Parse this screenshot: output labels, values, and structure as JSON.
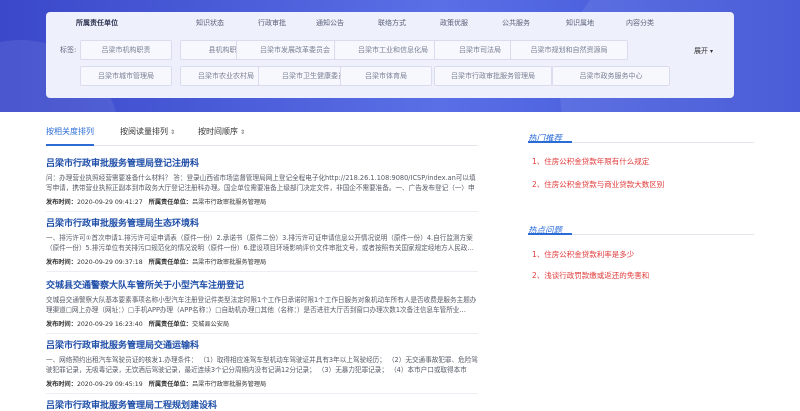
{
  "categories": [
    {
      "label": "所属责任单位",
      "active": true
    },
    {
      "label": "知识状态"
    },
    {
      "label": "行政审批"
    },
    {
      "label": "通知公告"
    },
    {
      "label": "联络方式"
    },
    {
      "label": "政策优服"
    },
    {
      "label": "公共服务"
    },
    {
      "label": "知识属地"
    },
    {
      "label": "内容分类"
    }
  ],
  "tags_label": "标签:",
  "tags": [
    "吕梁市机构职责",
    "县机构职责",
    "吕梁市发展改革委员会",
    "吕梁市工业和信息化局",
    "吕梁市司法局",
    "吕梁市规划和自然资源局",
    "吕梁市城市管理局",
    "吕梁市农业农村局",
    "吕梁市卫生健康委员会",
    "吕梁市体育局",
    "吕梁市行政审批服务管理局",
    "吕梁市政务服务中心"
  ],
  "expand_label": "展开",
  "sort_options": [
    {
      "label": "按相关度排列",
      "active": true
    },
    {
      "label": "按阅读量排列"
    },
    {
      "label": "按时间顺序"
    }
  ],
  "results": [
    {
      "title": "吕梁市行政审批服务管理局登记注册科",
      "desc": "问：办理营业执照经营需要准备什么材料？ 答：登录山西省市场监督管理局网上登记全程电子化http://218.26.1.108:9080/ICSP/index.an可以填写申请，携带营业执照正副本到市政务大厅登记注册科办理。国企单位需要准备上级部门决定文件，非国企不需要准备。一、广告发布登记（一）申请…",
      "published_label": "发布时间：",
      "published": "2020-09-29 09:41:27",
      "unit_label": "所属责任单位：",
      "unit": "吕梁市行政审批服务管理局"
    },
    {
      "title": "吕梁市行政审批服务管理局生态环境科",
      "desc": "一、排污许可①首次申请1.排污许可证申请表（原件一份）2.承诺书（原件二份）3.排污许可证申请信息公开情况说明（原件一份）4.自行监测方案（原件一份）5.排污单位有关排污口规范化的情况说明（原件一份）6.建设项目环境影响评价文件审批文号，或者按照有关国家规定经地方人民政…",
      "published_label": "发布时间：",
      "published": "2020-09-29 09:37:18",
      "unit_label": "所属责任单位：",
      "unit": "吕梁市行政审批服务管理局"
    },
    {
      "title": "交城县交通警察大队车管所关于小型汽车注册登记",
      "desc": "交城县交通警察大队基本要素事项名称小型汽车注册登记件类型法定时限1个工作日承诺时限1个工作日服务对象机动车所有人是否收费是服务主题办理渠道□网上办理（网址：）□手机APP办理（APP名称：）□自助机办理□其他（名称：）是否进驻大厅否到窗口办理次数1次备注信息车管所业…",
      "published_label": "发布时间：",
      "published": "2020-09-29 16:23:40",
      "unit_label": "所属责任单位：",
      "unit": "交城县公安局"
    },
    {
      "title": "吕梁市行政审批服务管理局交通运输科",
      "desc": "一、网络预约出租汽车驾驶员证的核发1.办理条件： （1）取得相应准驾车型机动车驾驶证并具有3年以上驾驶经历； （2）无交通事故犯罪、危险驾驶犯罪记录，无吸毒记录，无饮酒后驾驶记录，最近连续3个记分周期内没有记满12分记录； （3）无暴力犯罪记录； （4）本市户口或取得本市《…",
      "published_label": "发布时间：",
      "published": "2020-09-29 09:45:19",
      "unit_label": "所属责任单位：",
      "unit": "吕梁市行政审批服务管理局"
    },
    {
      "title": "吕梁市行政审批服务管理局工程规划建设科"
    }
  ],
  "hot_title": "热门推荐",
  "hot_items": [
    "1、住房公积金贷款年限有什么规定",
    "2、住房公积金贷款与商业贷款大数区别"
  ],
  "hotq_title": "热点问题",
  "hotq_items": [
    "1、住房公积金贷款利率是多少",
    "2、浅谈行政罚款缴或返还的免害和"
  ]
}
